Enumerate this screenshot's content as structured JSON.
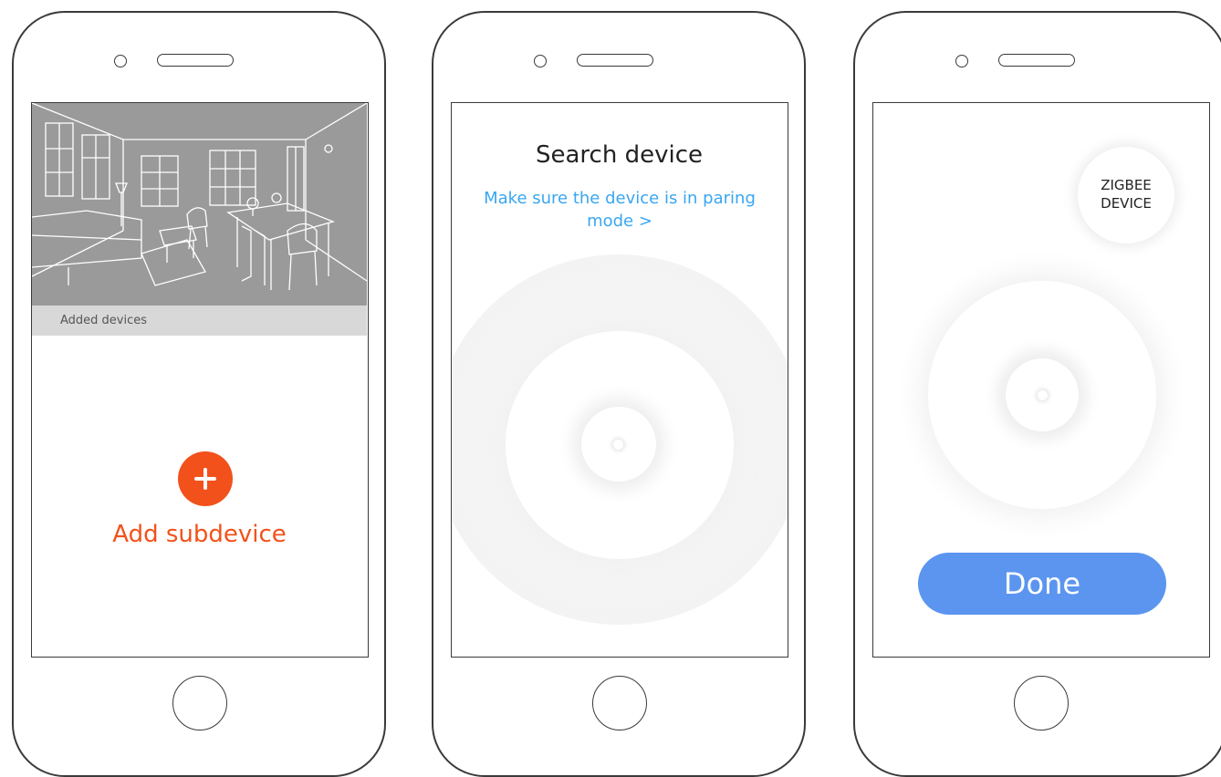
{
  "screen_add": {
    "added_devices_label": "Added devices",
    "add_icon": "plus-circle-icon",
    "add_label": "Add subdevice",
    "accent_color": "#f2511b"
  },
  "screen_search": {
    "title": "Search device",
    "hint": "Make sure the device is in paring mode >",
    "hint_color": "#3aa6f0"
  },
  "screen_done": {
    "device_line1": "ZIGBEE",
    "device_line2": "DEVICE",
    "done_label": "Done",
    "button_color": "#5b95ef"
  }
}
